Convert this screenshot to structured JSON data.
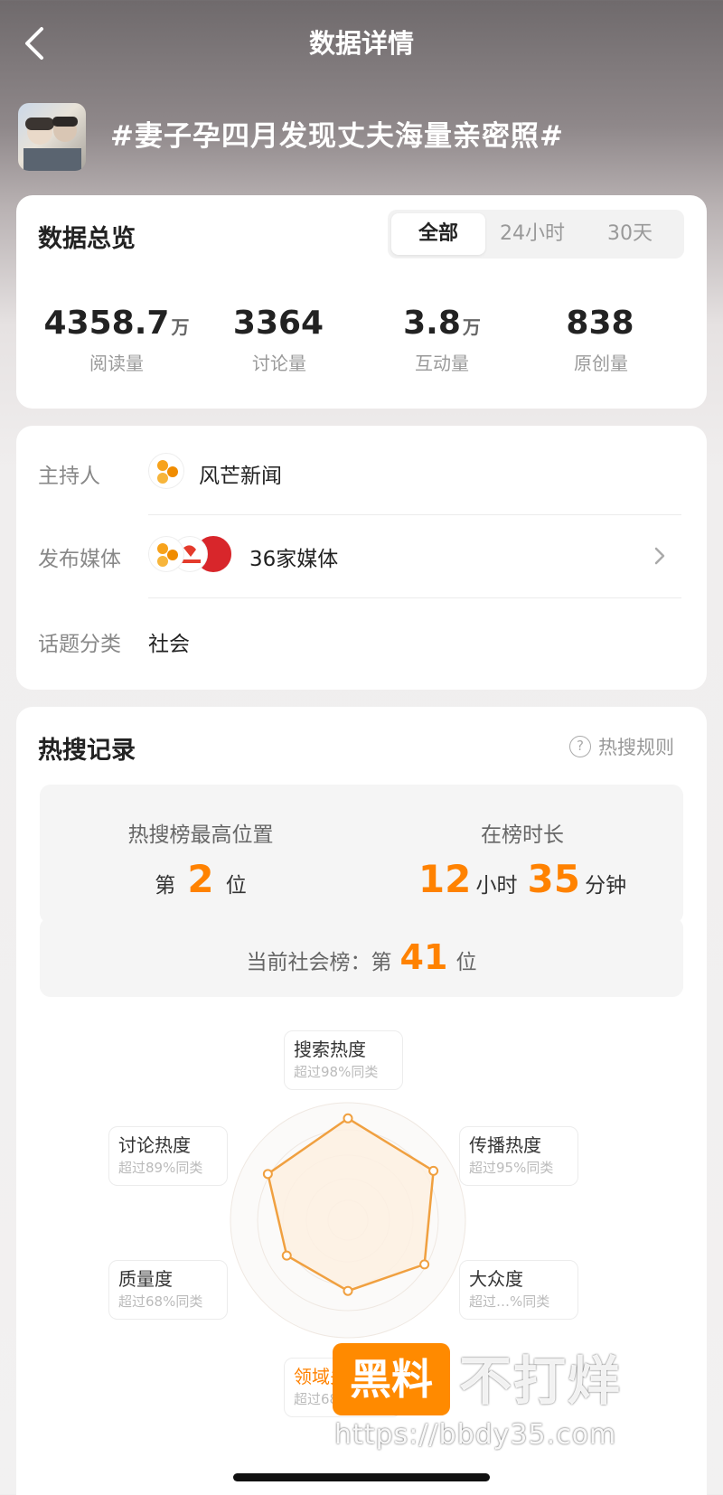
{
  "header": {
    "title": "数据详情"
  },
  "topic": {
    "title": "#妻子孕四月发现丈夫海量亲密照#"
  },
  "overview": {
    "title": "数据总览",
    "tabs": [
      "全部",
      "24小时",
      "30天"
    ],
    "active_tab": "全部",
    "stats": [
      {
        "value": "4358.7",
        "unit": "万",
        "label": "阅读量"
      },
      {
        "value": "3364",
        "unit": "",
        "label": "讨论量"
      },
      {
        "value": "3.8",
        "unit": "万",
        "label": "互动量"
      },
      {
        "value": "838",
        "unit": "",
        "label": "原创量"
      }
    ]
  },
  "info": {
    "host_label": "主持人",
    "host_value": "风芒新闻",
    "media_label": "发布媒体",
    "media_value": "36家媒体",
    "category_label": "话题分类",
    "category_value": "社会"
  },
  "hot": {
    "title": "热搜记录",
    "rules_label": "热搜规则",
    "peak_label": "热搜榜最高位置",
    "peak_prefix": "第",
    "peak_rank": "2",
    "peak_suffix": "位",
    "duration_label": "在榜时长",
    "duration_hours": "12",
    "hours_unit": "小时",
    "duration_minutes": "35",
    "minutes_unit": "分钟",
    "current_prefix": "当前社会榜：第",
    "current_rank": "41",
    "current_suffix": "位",
    "radar": [
      {
        "name": "搜索热度",
        "note": "超过98%同类"
      },
      {
        "name": "传播热度",
        "note": "超过95%同类"
      },
      {
        "name": "讨论热度",
        "note": "超过89%同类"
      },
      {
        "name": "质量度",
        "note": "超过68%同类"
      },
      {
        "name": "大众度",
        "note": "超过…%同类"
      },
      {
        "name": "领域关注度",
        "note": "超过68%同类"
      }
    ],
    "radar_values": [
      0.98,
      0.95,
      0.89,
      0.68,
      0.85,
      0.68
    ]
  },
  "watermark": {
    "badge": "黑料",
    "text": "不打烊",
    "url": "https://bbdy35.com"
  },
  "colors": {
    "accent": "#ff8200",
    "radar_line": "#f0a040",
    "radar_fill": "#fdf0e2"
  }
}
